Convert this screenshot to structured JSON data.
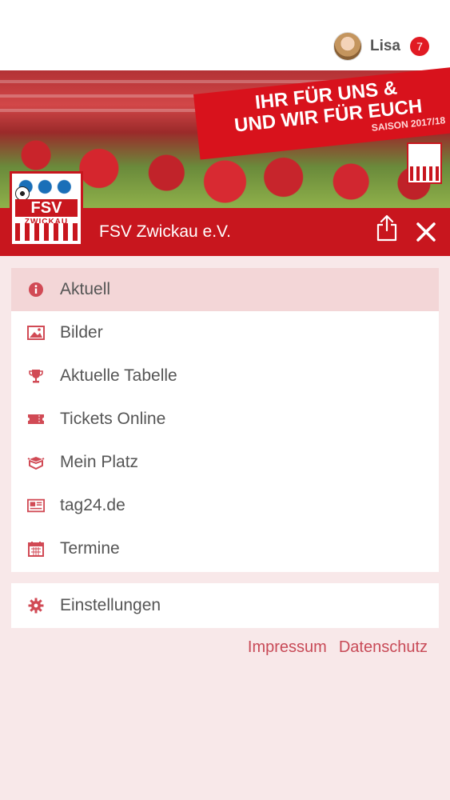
{
  "header": {
    "user_name": "Lisa",
    "notification_count": "7"
  },
  "banner": {
    "slogan_line1": "IHR FÜR UNS &",
    "slogan_line2": "UND WIR FÜR EUCH",
    "season": "SAISON 2017/18"
  },
  "club": {
    "crest_text": "FSV",
    "crest_subtext": "ZWICKAU",
    "name": "FSV Zwickau e.V."
  },
  "menu": {
    "items": [
      {
        "label": "Aktuell",
        "icon": "info-icon"
      },
      {
        "label": "Bilder",
        "icon": "image-icon"
      },
      {
        "label": "Aktuelle Tabelle",
        "icon": "trophy-icon"
      },
      {
        "label": "Tickets Online",
        "icon": "ticket-icon"
      },
      {
        "label": "Mein Platz",
        "icon": "box-icon"
      },
      {
        "label": "tag24.de",
        "icon": "newspaper-icon"
      },
      {
        "label": "Termine",
        "icon": "calendar-icon"
      }
    ]
  },
  "settings": {
    "label": "Einstellungen",
    "icon": "gear-icon"
  },
  "footer": {
    "impressum": "Impressum",
    "datenschutz": "Datenschutz"
  },
  "colors": {
    "brand_red": "#c8161e",
    "active_bg": "#f3d6d7",
    "page_bg": "#f8e8e9",
    "icon_red": "#d14a55",
    "badge_red": "#e11a23"
  }
}
